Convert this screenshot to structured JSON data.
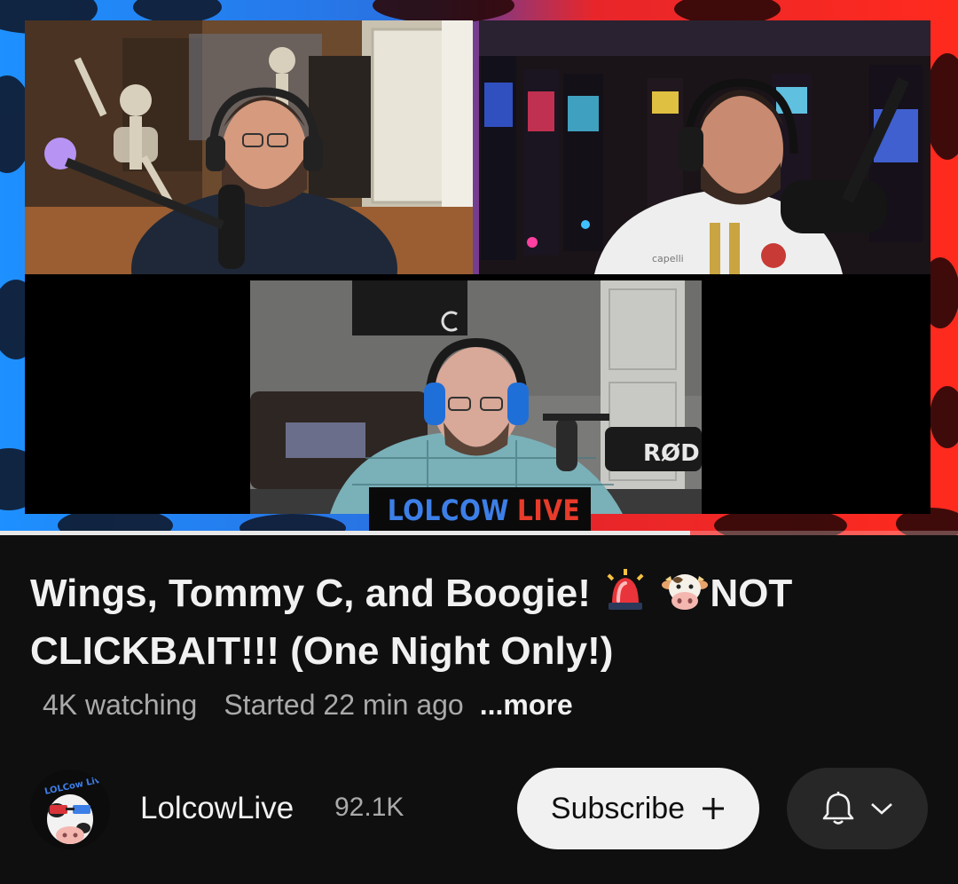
{
  "player": {
    "brand_word1": "LOLCOW",
    "brand_word2": "LIVE",
    "mic_brand": "RØDE",
    "shirt_text": "capelli",
    "progress": 0.72
  },
  "video": {
    "title_part1": "Wings, Tommy C, and Boogie!",
    "title_part2": "NOT CLICKBAIT!!! (One Night Only!)",
    "emoji_1": "siren-icon",
    "emoji_2": "cow-face-icon",
    "watching": "4K watching",
    "started": "Started 22 min ago",
    "more_label": "...more"
  },
  "channel": {
    "name": "LolcowLive",
    "subscribers": "92.1K",
    "avatar_text": "LOLCow Live",
    "subscribe_label": "Subscribe"
  },
  "colors": {
    "accent_blue": "#3d7fe8",
    "accent_red": "#e83b2a",
    "background": "#0f0f0f"
  }
}
